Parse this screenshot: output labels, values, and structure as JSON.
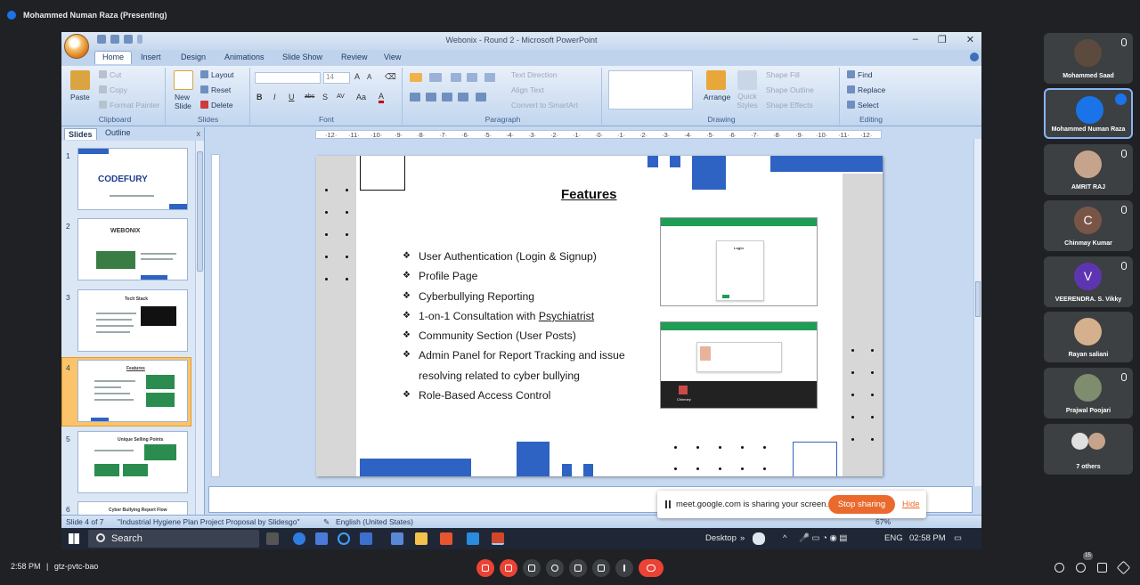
{
  "meet": {
    "presenter_label": "Mohammed Numan Raza (Presenting)",
    "clock": "2:58 PM",
    "separator": "|",
    "meeting_code": "gtz-pvtc-bao",
    "participants_badge": "15"
  },
  "ppt": {
    "window_title": "Webonix - Round 2 - Microsoft PowerPoint",
    "window_controls": [
      "–",
      "❐",
      "✕"
    ],
    "tabs": [
      "Home",
      "Insert",
      "Design",
      "Animations",
      "Slide Show",
      "Review",
      "View"
    ],
    "clipboard": {
      "paste": "Paste",
      "cut": "Cut",
      "copy": "Copy",
      "format_painter": "Format Painter",
      "label": "Clipboard"
    },
    "slides_group": {
      "new_slide": "New Slide",
      "layout": "Layout",
      "reset": "Reset",
      "delete": "Delete",
      "label": "Slides"
    },
    "font_group": {
      "font_name": "",
      "font_size": "14",
      "bold": "B",
      "italic": "I",
      "underline": "U",
      "strike": "abc",
      "shadow": "S",
      "spacing": "AV",
      "case": "Aa",
      "color": "A",
      "label": "Font"
    },
    "paragraph_group": {
      "text_direction": "Text Direction",
      "align_text": "Align Text",
      "convert_smartart": "Convert to SmartArt",
      "label": "Paragraph"
    },
    "drawing_group": {
      "arrange": "Arrange",
      "quick_styles": "Quick Styles",
      "shape_fill": "Shape Fill",
      "shape_outline": "Shape Outline",
      "shape_effects": "Shape Effects",
      "label": "Drawing"
    },
    "editing_group": {
      "find": "Find",
      "replace": "Replace",
      "select": "Select",
      "label": "Editing"
    },
    "pane_tabs": {
      "slides": "Slides",
      "outline": "Outline",
      "close": "x"
    },
    "thumbnails": [
      {
        "num": "1",
        "title": "CODEFURY"
      },
      {
        "num": "2",
        "title": "WEBONIX"
      },
      {
        "num": "3",
        "title": "Tech Stack"
      },
      {
        "num": "4",
        "title": "Features"
      },
      {
        "num": "5",
        "title": "Unique Selling Points"
      },
      {
        "num": "6",
        "title": "Cyber Bullying Report Flow"
      }
    ],
    "status": {
      "slide": "Slide 4 of 7",
      "theme": "\"Industrial Hygiene Plan Project Proposal by Slidesgo\"",
      "language": "English (United States)",
      "zoom": "67%"
    }
  },
  "slide": {
    "title": "Features",
    "bullets": [
      "User Authentication (Login & Signup)",
      "Profile Page",
      "Cyberbullying Reporting",
      "1-on-1 Consultation with ",
      "Community Section (User Posts)",
      "Admin Panel for Report Tracking and issue",
      "resolving related to cyber bullying",
      "Role-Based Access Control"
    ],
    "psychiatrist": "Psychiatrist",
    "shot1_caption": "Login",
    "shot2_footer": "Chimney"
  },
  "taskbar": {
    "search": "Search",
    "desktop": "Desktop",
    "lang": "ENG",
    "time": "02:58 PM"
  },
  "share_notice": {
    "message": "meet.google.com is sharing your screen.",
    "stop": "Stop sharing",
    "hide": "Hide"
  },
  "participants": [
    {
      "name": "Mohammed Saad",
      "avatar": "",
      "color": "#5d4a3e"
    },
    {
      "name": "Mohammed Numan Raza",
      "avatar": "",
      "color": "#1a73e8"
    },
    {
      "name": "AMRIT RAJ",
      "avatar": "",
      "color": "#c6a48c"
    },
    {
      "name": "Chinmay Kumar",
      "avatar": "C",
      "color": "#795548"
    },
    {
      "name": "VEERENDRA. S. Vikky",
      "avatar": "V",
      "color": "#5e35b1"
    },
    {
      "name": "Rayan saliani",
      "avatar": "",
      "color": "#d4b08c"
    },
    {
      "name": "Prajwal Poojari",
      "avatar": "",
      "color": "#7f8c6d"
    },
    {
      "name": "7 others",
      "avatar": "",
      "color": "#e0e0e0"
    }
  ]
}
